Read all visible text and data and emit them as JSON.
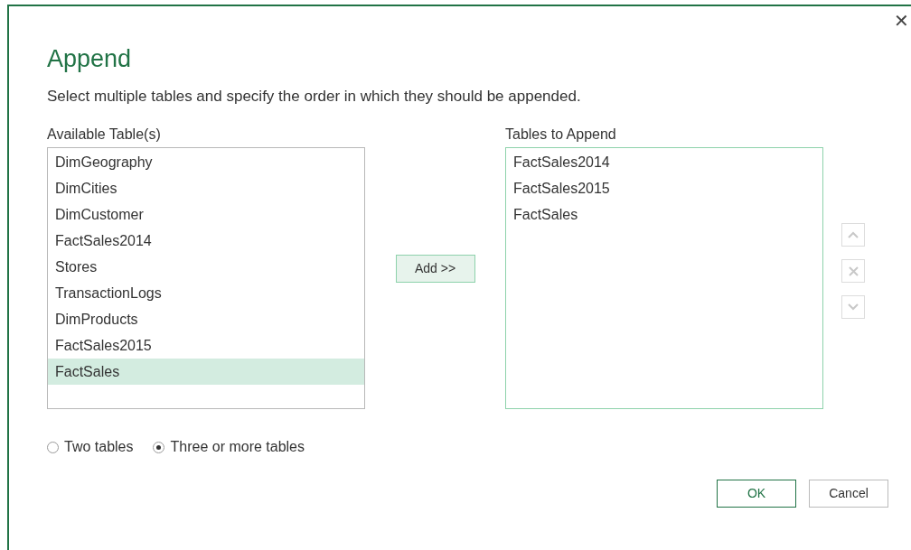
{
  "dialog": {
    "title": "Append",
    "close": "✕",
    "description": "Select multiple tables and specify the order in which they should be appended.",
    "available": {
      "label": "Available Table(s)",
      "items": [
        {
          "label": "DimGeography",
          "selected": false
        },
        {
          "label": "DimCities",
          "selected": false
        },
        {
          "label": "DimCustomer",
          "selected": false
        },
        {
          "label": "FactSales2014",
          "selected": false
        },
        {
          "label": "Stores",
          "selected": false
        },
        {
          "label": "TransactionLogs",
          "selected": false
        },
        {
          "label": "DimProducts",
          "selected": false
        },
        {
          "label": "FactSales2015",
          "selected": false
        },
        {
          "label": "FactSales",
          "selected": true
        }
      ]
    },
    "add_button": "Add >>",
    "to_append": {
      "label": "Tables to Append",
      "items": [
        {
          "label": "FactSales2014",
          "selected": false
        },
        {
          "label": "FactSales2015",
          "selected": false
        },
        {
          "label": "FactSales",
          "selected": false
        }
      ]
    },
    "order_buttons": [
      {
        "kind": "up",
        "disabled": true
      },
      {
        "kind": "remove",
        "disabled": true
      },
      {
        "kind": "down",
        "disabled": true
      }
    ],
    "mode": [
      {
        "label": "Two tables",
        "selected": false
      },
      {
        "label": "Three or more tables",
        "selected": true
      }
    ],
    "buttons": [
      {
        "label": "OK",
        "kind": "primary"
      },
      {
        "label": "Cancel",
        "kind": "secondary"
      }
    ]
  }
}
